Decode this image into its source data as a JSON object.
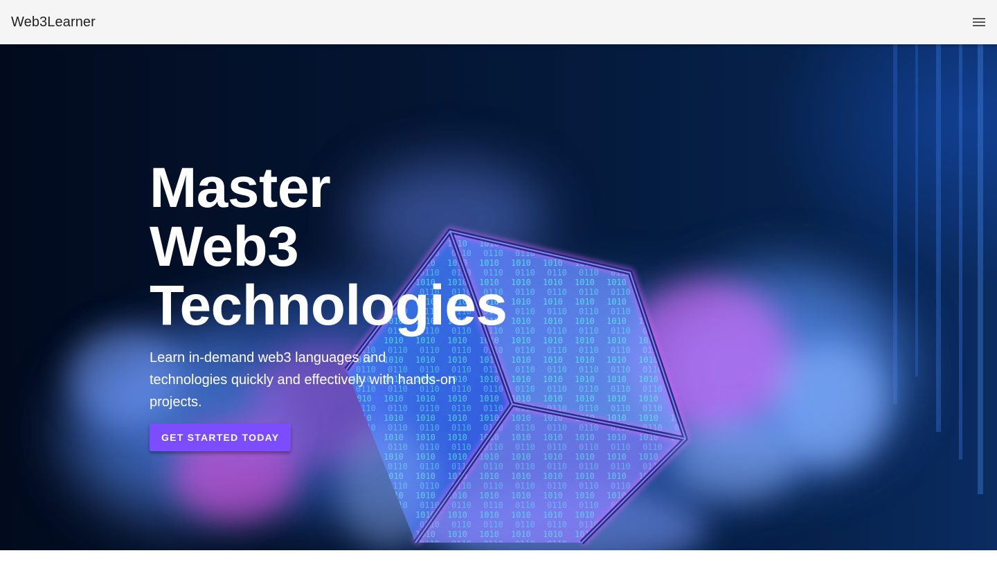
{
  "appbar": {
    "brand": "Web3Learner",
    "menu_icon": "hamburger-menu-icon"
  },
  "hero": {
    "headline_lines": [
      "Master",
      "Web3",
      "Technologies"
    ],
    "subtitle": "Learn in-demand web3 languages and technologies quickly and effectively with hands-on projects.",
    "cta_label": "GET STARTED TODAY",
    "background_image": "glowing-binary-cube-in-clouds-image"
  },
  "colors": {
    "appbar_bg": "#f5f5f5",
    "accent": "#7c4dff",
    "hero_bg": "#041634"
  }
}
